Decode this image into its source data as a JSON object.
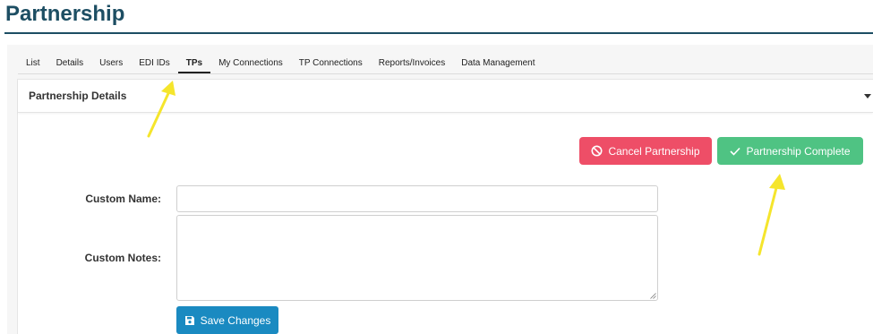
{
  "page": {
    "title": "Partnership"
  },
  "tabs": [
    {
      "label": "List"
    },
    {
      "label": "Details"
    },
    {
      "label": "Users"
    },
    {
      "label": "EDI IDs"
    },
    {
      "label": "TPs",
      "active": true
    },
    {
      "label": "My Connections"
    },
    {
      "label": "TP Connections"
    },
    {
      "label": "Reports/Invoices"
    },
    {
      "label": "Data Management"
    }
  ],
  "panel": {
    "title": "Partnership Details",
    "caret_icon": "caret-down-icon"
  },
  "actions": {
    "cancel_label": "Cancel Partnership",
    "cancel_icon": "ban-icon",
    "complete_label": "Partnership Complete",
    "complete_icon": "check-icon"
  },
  "form": {
    "custom_name_label": "Custom Name:",
    "custom_name_value": "",
    "custom_notes_label": "Custom Notes:",
    "custom_notes_value": "",
    "save_label": "Save Changes",
    "save_icon": "floppy-disk-icon"
  },
  "colors": {
    "title": "#1d4e63",
    "cancel": "#ee4e67",
    "complete": "#4fc383",
    "save": "#1a8ac1",
    "annotation_arrow": "#f5e52c"
  },
  "annotations": [
    {
      "type": "arrow",
      "target": "TPs tab"
    },
    {
      "type": "arrow",
      "target": "Partnership Complete button"
    }
  ]
}
